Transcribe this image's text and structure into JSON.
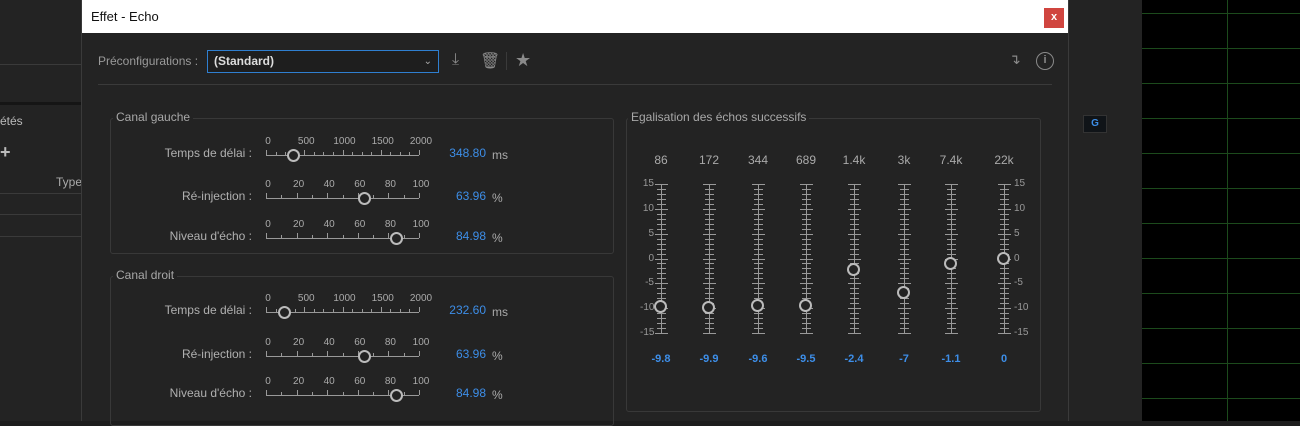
{
  "background_panel": {
    "tab_partial": "étés",
    "column_type": "Type",
    "badge": "G"
  },
  "dialog": {
    "title": "Effet - Echo",
    "close_label": "x",
    "presets": {
      "label": "Préconfigurations :",
      "value": "(Standard)"
    },
    "left_channel": {
      "title": "Canal gauche",
      "rows": [
        {
          "label": "Temps de délai :",
          "ticks": [
            "0",
            "500",
            "1000",
            "1500",
            "2000"
          ],
          "min": 0,
          "max": 2000,
          "value": 348.8,
          "value_text": "348.80",
          "unit": "ms"
        },
        {
          "label": "Ré-injection :",
          "ticks": [
            "0",
            "20",
            "40",
            "60",
            "80",
            "100"
          ],
          "min": 0,
          "max": 100,
          "value": 63.96,
          "value_text": "63.96",
          "unit": "%"
        },
        {
          "label": "Niveau d'écho :",
          "ticks": [
            "0",
            "20",
            "40",
            "60",
            "80",
            "100"
          ],
          "min": 0,
          "max": 100,
          "value": 84.98,
          "value_text": "84.98",
          "unit": "%"
        }
      ]
    },
    "right_channel": {
      "title": "Canal droit",
      "rows": [
        {
          "label": "Temps de délai :",
          "ticks": [
            "0",
            "500",
            "1000",
            "1500",
            "2000"
          ],
          "min": 0,
          "max": 2000,
          "value": 232.6,
          "value_text": "232.60",
          "unit": "ms"
        },
        {
          "label": "Ré-injection :",
          "ticks": [
            "0",
            "20",
            "40",
            "60",
            "80",
            "100"
          ],
          "min": 0,
          "max": 100,
          "value": 63.96,
          "value_text": "63.96",
          "unit": "%"
        },
        {
          "label": "Niveau d'écho :",
          "ticks": [
            "0",
            "20",
            "40",
            "60",
            "80",
            "100"
          ],
          "min": 0,
          "max": 100,
          "value": 84.98,
          "value_text": "84.98",
          "unit": "%"
        }
      ]
    },
    "eq": {
      "title": "Egalisation des échos successifs",
      "scale": [
        "15",
        "10",
        "5",
        "0",
        "-5",
        "-10",
        "-15"
      ],
      "min": -15,
      "max": 15,
      "bands": [
        {
          "freq": "86",
          "value": -9.8,
          "value_text": "-9.8"
        },
        {
          "freq": "172",
          "value": -9.9,
          "value_text": "-9.9"
        },
        {
          "freq": "344",
          "value": -9.6,
          "value_text": "-9.6"
        },
        {
          "freq": "689",
          "value": -9.5,
          "value_text": "-9.5"
        },
        {
          "freq": "1.4k",
          "value": -2.4,
          "value_text": "-2.4"
        },
        {
          "freq": "3k",
          "value": -7,
          "value_text": "-7"
        },
        {
          "freq": "7.4k",
          "value": -1.1,
          "value_text": "-1.1"
        },
        {
          "freq": "22k",
          "value": 0,
          "value_text": "0"
        }
      ]
    }
  }
}
